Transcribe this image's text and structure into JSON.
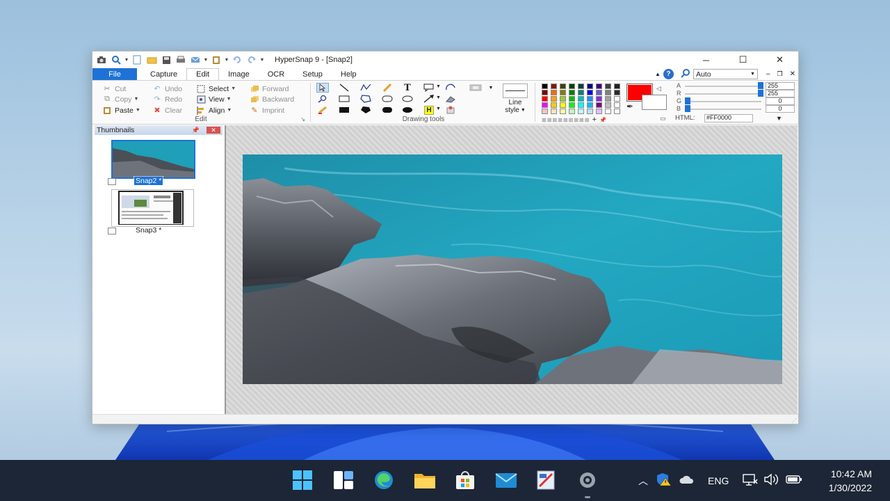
{
  "window": {
    "title": "HyperSnap 9 - [Snap2]",
    "controls": {
      "minimize": "─",
      "maximize": "☐",
      "close": "✕"
    }
  },
  "menubar": {
    "tabs": [
      {
        "label": "File"
      },
      {
        "label": "Capture"
      },
      {
        "label": "Edit"
      },
      {
        "label": "Image"
      },
      {
        "label": "OCR"
      },
      {
        "label": "Setup"
      },
      {
        "label": "Help"
      }
    ],
    "active_tab": "Edit",
    "zoom_value": "Auto"
  },
  "ribbon": {
    "edit_group": {
      "label": "Edit",
      "cut": "Cut",
      "copy": "Copy",
      "paste": "Paste",
      "undo": "Undo",
      "redo": "Redo",
      "clear": "Clear",
      "select": "Select",
      "view": "View",
      "align": "Align",
      "forward": "Forward",
      "backward": "Backward",
      "imprint": "Imprint"
    },
    "drawing_group": {
      "label": "Drawing tools",
      "text_tool": "T",
      "highlight_tool": "H",
      "line_style_line1": "Line",
      "line_style_line2": "style"
    },
    "color_group": {
      "current_color": "#FF0000",
      "r_label": "R",
      "g_label": "G",
      "b_label": "B",
      "a_label": "A",
      "a_value": "255",
      "r_value": "255",
      "g_value": "0",
      "b_value": "0",
      "html_label": "HTML:",
      "html_value": "#FF0000",
      "palette": [
        [
          "#000000",
          "#7f1a00",
          "#3f3f00",
          "#004000",
          "#003f3f",
          "#00007f",
          "#3f007f",
          "#3f3f3f",
          "#202020"
        ],
        [
          "#800000",
          "#ff6a00",
          "#808000",
          "#008000",
          "#008080",
          "#0000ff",
          "#6a5acd",
          "#808080",
          "#2a2a2a"
        ],
        [
          "#ff0000",
          "#ffa500",
          "#9acd32",
          "#00c000",
          "#00bfbf",
          "#1e90ff",
          "#8a2be2",
          "#a0a0a0",
          "#ffffff"
        ],
        [
          "#ff00ff",
          "#ffcc00",
          "#ffff00",
          "#00ff00",
          "#00ffff",
          "#00bfff",
          "#800080",
          "#c0c0c0",
          "#ffffff"
        ],
        [
          "#ffc0cb",
          "#ffe4b5",
          "#ffffa0",
          "#c0ffc0",
          "#c0ffff",
          "#c0e0ff",
          "#e0c0ff",
          "#ffffff",
          "#ffffff"
        ]
      ]
    }
  },
  "thumbnails": {
    "title": "Thumbnails",
    "items": [
      {
        "label": "Snap2 *",
        "selected": true
      },
      {
        "label": "Snap3 *",
        "selected": false
      }
    ]
  },
  "taskbar": {
    "language": "ENG",
    "time": "10:42 AM",
    "date": "1/30/2022",
    "apps": [
      "start-icon",
      "widgets-icon",
      "edge-icon",
      "file-explorer-icon",
      "store-icon",
      "mail-icon",
      "hypersnap-icon",
      "settings-icon"
    ]
  }
}
